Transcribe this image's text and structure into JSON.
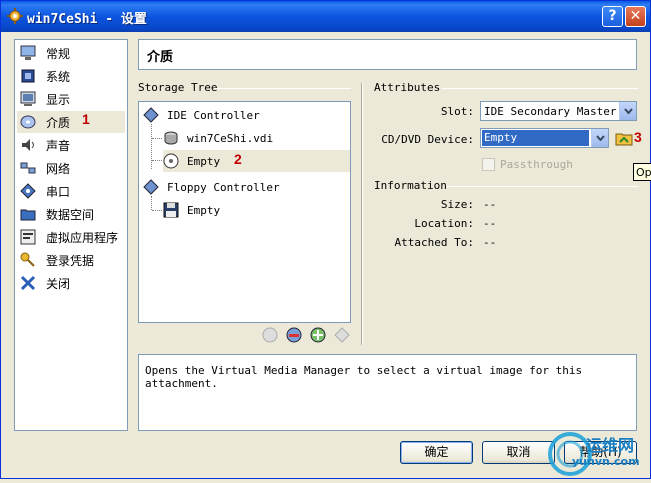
{
  "window": {
    "title": "win7CeShi - 设置",
    "help_button": "?",
    "close_button": "✕"
  },
  "nav": {
    "items": [
      {
        "label": "常规",
        "icon": "monitor-icon"
      },
      {
        "label": "系统",
        "icon": "chip-icon"
      },
      {
        "label": "显示",
        "icon": "display-icon"
      },
      {
        "label": "介质",
        "icon": "disc-icon"
      },
      {
        "label": "声音",
        "icon": "speaker-icon"
      },
      {
        "label": "网络",
        "icon": "network-icon"
      },
      {
        "label": "串口",
        "icon": "serial-port-icon"
      },
      {
        "label": "数据空间",
        "icon": "folder-icon"
      },
      {
        "label": "虚拟应用程序",
        "icon": "virtual-app-icon"
      },
      {
        "label": "登录凭据",
        "icon": "key-icon"
      },
      {
        "label": "关闭",
        "icon": "close-x-icon"
      }
    ],
    "selected_index": 3
  },
  "annotations": {
    "n1": "1",
    "n2": "2",
    "n3": "3"
  },
  "section_title": "介质",
  "storage": {
    "group_label": "Storage Tree",
    "tree": [
      {
        "label": "IDE Controller",
        "type": "controller"
      },
      {
        "label": "win7CeShi.vdi",
        "type": "harddisk"
      },
      {
        "label": "Empty",
        "type": "cdrom",
        "selected": true
      },
      {
        "label": "Floppy Controller",
        "type": "controller"
      },
      {
        "label": "Empty",
        "type": "floppy"
      }
    ]
  },
  "attributes": {
    "group_label": "Attributes",
    "slot_label": "Slot:",
    "slot_value": "IDE Secondary Master",
    "cd_label": "CD/DVD Device:",
    "cd_value": "Empty",
    "passthrough_label": "Passthrough",
    "passthrough_checked": false
  },
  "information": {
    "group_label": "Information",
    "size_label": "Size:",
    "size_value": "--",
    "location_label": "Location:",
    "location_value": "--",
    "attached_label": "Attached To:",
    "attached_value": "--"
  },
  "description": "Opens the Virtual Media Manager to select a virtual image for this attachment.",
  "tooltip": "Ope",
  "buttons": {
    "ok": "确定",
    "cancel": "取消",
    "help": "帮助(H)"
  },
  "watermark": {
    "line1": "运维网",
    "line2": "yunvn.com"
  },
  "colors": {
    "titlebar": "#0a59e6",
    "selection": "#316ac5",
    "annotation": "#c00000"
  }
}
